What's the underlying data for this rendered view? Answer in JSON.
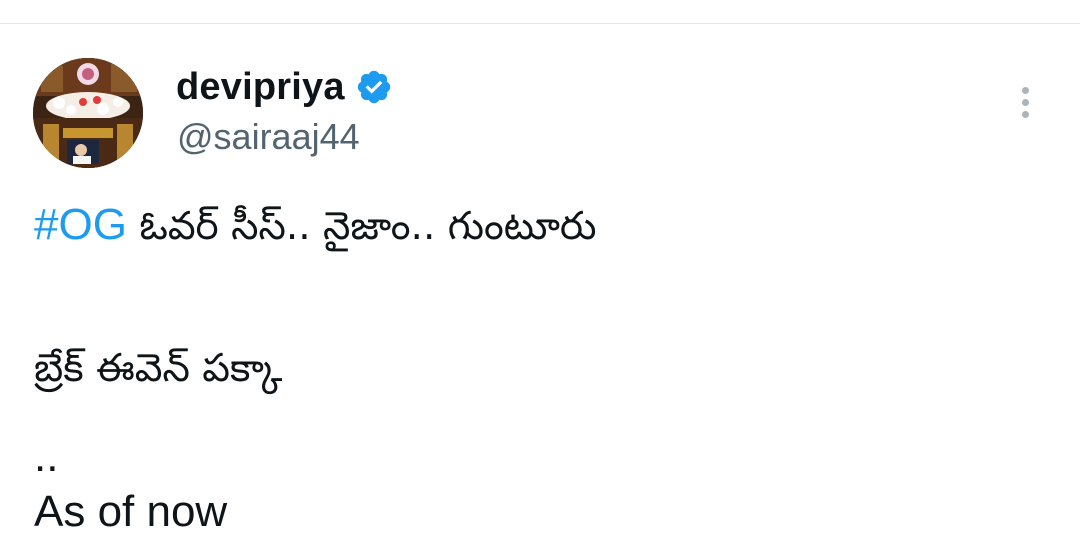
{
  "user": {
    "display_name": "devipriya",
    "handle": "@sairaaj44",
    "verified_icon": "verified-badge-icon"
  },
  "menu": {
    "icon": "more-vertical-icon"
  },
  "tweet": {
    "hashtag": "#OG",
    "line1_rest": " ఓవర్ సీస్.. నైజాం.. గుంటూరు",
    "line2": "బ్రేక్ ఈవెన్ పక్కా",
    "line3": "..",
    "line4": "As of now"
  },
  "colors": {
    "accent": "#1d9bf0",
    "text": "#0f1419",
    "secondary": "#536471"
  }
}
